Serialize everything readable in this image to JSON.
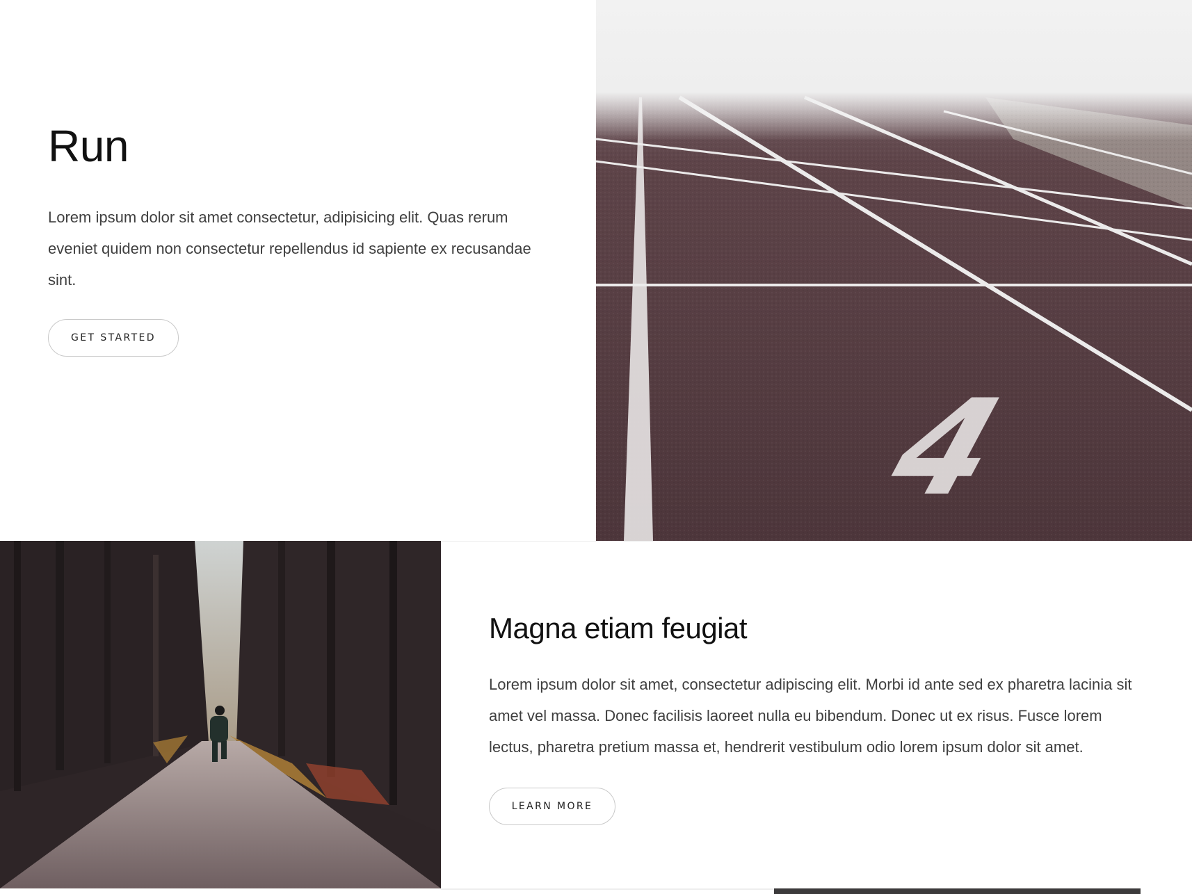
{
  "hero": {
    "title": "Run",
    "description": "Lorem ipsum dolor sit amet consectetur, adipisicing elit. Quas rerum eveniet quidem non consectetur repellendus id sapiente ex recusandae sint.",
    "button_label": "GET STARTED",
    "image_icon": "running-track-image",
    "lane_number": "4"
  },
  "feature": {
    "title": "Magna etiam feugiat",
    "description": "Lorem ipsum dolor sit amet, consectetur adipiscing elit. Morbi id ante sed ex pharetra lacinia sit amet vel massa. Donec facilisis laoreet nulla eu bibendum. Donec ut ex risus. Fusce lorem lectus, pharetra pretium massa et, hendrerit vestibulum odio lorem ipsum dolor sit amet.",
    "button_label": "LEARN MORE",
    "image_icon": "forest-runner-image"
  },
  "colors": {
    "track": "#5a3f44",
    "forest_dark": "#2e2527",
    "button_border": "#c9c9c9"
  }
}
